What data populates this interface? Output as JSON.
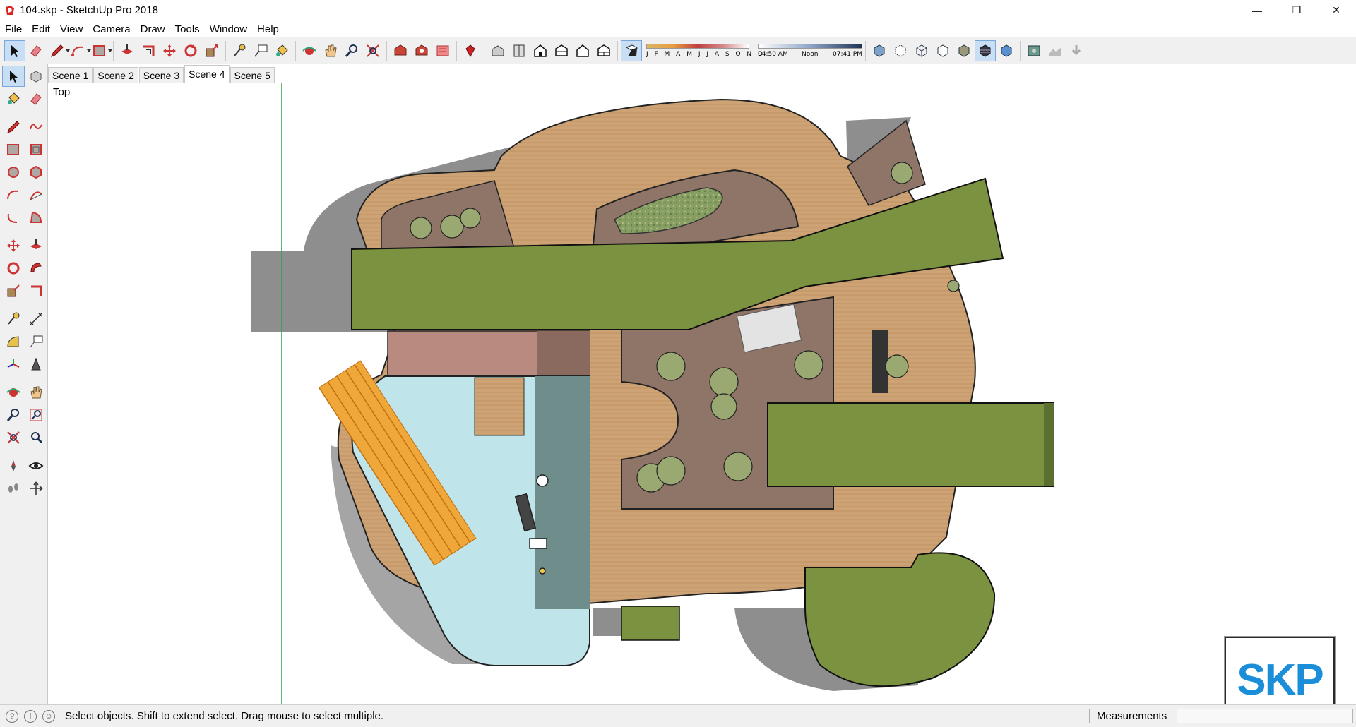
{
  "window": {
    "title": "104.skp - SketchUp Pro 2018",
    "minimize": "—",
    "restore": "❐",
    "close": "✕"
  },
  "menu": [
    "File",
    "Edit",
    "View",
    "Camera",
    "Draw",
    "Tools",
    "Window",
    "Help"
  ],
  "shadow": {
    "months": "J F M A M J J A S O N D",
    "time_start": "04:50 AM",
    "time_mid": "Noon",
    "time_end": "07:41 PM"
  },
  "scenes": [
    "Scene 1",
    "Scene 2",
    "Scene 3",
    "Scene 4",
    "Scene 5"
  ],
  "active_scene": "Scene 4",
  "view_label": "Top",
  "status": {
    "text": "Select objects. Shift to extend select. Drag mouse to select multiple.",
    "measurements_label": "Measurements",
    "measurements_value": ""
  },
  "logo": {
    "text": "SKP"
  },
  "colors": {
    "deck": "#c9a06e",
    "green_roof": "#7b9240",
    "paving": "#8f7468",
    "pool": "#bfe4ea",
    "water_dark": "#6f8d8a",
    "shadow": "#8e8e8e",
    "bench": "#f0a73a"
  }
}
